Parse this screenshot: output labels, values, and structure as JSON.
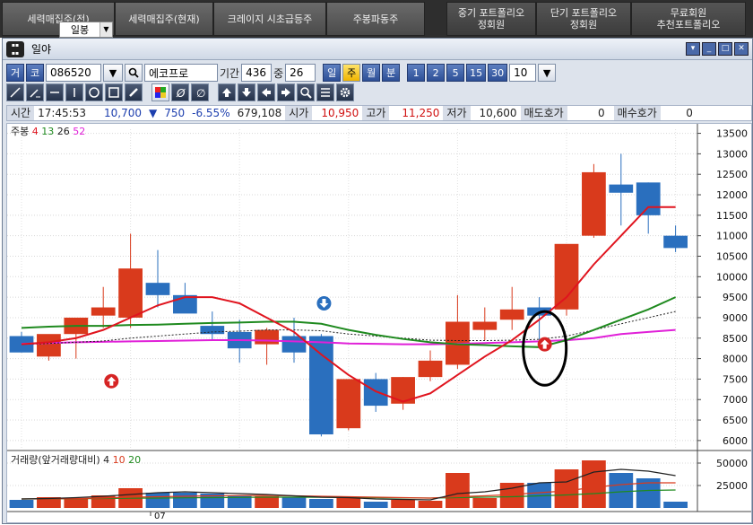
{
  "tabs": [
    {
      "label": "세력매집주(전)"
    },
    {
      "label": "세력매집주(현재)"
    },
    {
      "label": "크레이지 시초급등주"
    },
    {
      "label": "주봉파동주"
    },
    {
      "label": "중기 포트폴리오\n정회원"
    },
    {
      "label": "단기 포트폴리오\n정회원"
    },
    {
      "label": "무료회원\n추천포트폴리오"
    }
  ],
  "period_select": "일봉",
  "window": {
    "title": "일야"
  },
  "toolbar": {
    "geo": "거",
    "code_lbl": "코",
    "code": "086520",
    "name": "에코프로",
    "period_lbl": "기간",
    "period": "436",
    "mid_lbl": "중",
    "mid": "26",
    "p_day": "일",
    "p_week": "주",
    "p_month": "월",
    "p_min": "분",
    "n1": "1",
    "n2": "2",
    "n5": "5",
    "n15": "15",
    "n30": "30",
    "count": "10"
  },
  "quote": {
    "time_lbl": "시간",
    "time": "17:45:53",
    "price": "10,700",
    "change_arrow": "▼",
    "change": "750",
    "pct": "-6.55%",
    "volume": "679,108",
    "open_lbl": "시가",
    "open": "10,950",
    "high_lbl": "고가",
    "high": "11,250",
    "low_lbl": "저가",
    "low": "10,600",
    "ask_lbl": "매도호가",
    "ask": "0",
    "bid_lbl": "매수호가",
    "bid": "0"
  },
  "colors": {
    "up": "#d93a1c",
    "down": "#2a6fbe",
    "ma4": "#e0141e",
    "ma13": "#1f8a1f",
    "ma26": "#222222",
    "ma52": "#e020d8"
  },
  "chart_data": {
    "type": "candlestick",
    "title": "주봉",
    "ma_legend": [
      {
        "label": "4",
        "color": "#e0141e"
      },
      {
        "label": "13",
        "color": "#1f8a1f"
      },
      {
        "label": "26",
        "color": "#222222"
      },
      {
        "label": "52",
        "color": "#e020d8"
      }
    ],
    "ylim": [
      5800,
      13600
    ],
    "yticks": [
      6000,
      6500,
      7000,
      7500,
      8000,
      8500,
      9000,
      9500,
      10000,
      10500,
      11000,
      11500,
      12000,
      12500,
      13000,
      13500
    ],
    "x_label": "07",
    "candles": [
      {
        "o": 8550,
        "h": 8650,
        "l": 8150,
        "c": 8150
      },
      {
        "o": 8050,
        "h": 8550,
        "l": 7950,
        "c": 8600
      },
      {
        "o": 8600,
        "h": 8850,
        "l": 8000,
        "c": 9000
      },
      {
        "o": 9050,
        "h": 9750,
        "l": 8750,
        "c": 9250
      },
      {
        "o": 9000,
        "h": 11050,
        "l": 8750,
        "c": 10200
      },
      {
        "o": 9850,
        "h": 10650,
        "l": 9250,
        "c": 9550
      },
      {
        "o": 9550,
        "h": 9850,
        "l": 9300,
        "c": 9100
      },
      {
        "o": 8800,
        "h": 9150,
        "l": 8450,
        "c": 8600
      },
      {
        "o": 8650,
        "h": 8950,
        "l": 7900,
        "c": 8250
      },
      {
        "o": 8350,
        "h": 8750,
        "l": 7850,
        "c": 8700
      },
      {
        "o": 8550,
        "h": 9000,
        "l": 7900,
        "c": 8150
      },
      {
        "o": 8550,
        "h": 8600,
        "l": 6100,
        "c": 6150
      },
      {
        "o": 6300,
        "h": 7500,
        "l": 6250,
        "c": 7500
      },
      {
        "o": 7500,
        "h": 7650,
        "l": 6700,
        "c": 6850
      },
      {
        "o": 6900,
        "h": 7550,
        "l": 6750,
        "c": 7550
      },
      {
        "o": 7550,
        "h": 8200,
        "l": 7450,
        "c": 7950
      },
      {
        "o": 7850,
        "h": 9550,
        "l": 7750,
        "c": 8900
      },
      {
        "o": 8700,
        "h": 9250,
        "l": 8450,
        "c": 8900
      },
      {
        "o": 8950,
        "h": 9750,
        "l": 8700,
        "c": 9200
      },
      {
        "o": 9250,
        "h": 9500,
        "l": 8450,
        "c": 9050
      },
      {
        "o": 9200,
        "h": 10750,
        "l": 9050,
        "c": 10800
      },
      {
        "o": 11000,
        "h": 12750,
        "l": 10950,
        "c": 12550
      },
      {
        "o": 12250,
        "h": 13000,
        "l": 11250,
        "c": 12050
      },
      {
        "o": 12300,
        "h": 12300,
        "l": 11050,
        "c": 11500
      },
      {
        "o": 11000,
        "h": 11250,
        "l": 10600,
        "c": 10700
      }
    ],
    "ma4": [
      8350,
      8400,
      8500,
      8700,
      9000,
      9300,
      9500,
      9500,
      9350,
      9000,
      8650,
      8100,
      7600,
      7200,
      6950,
      7150,
      7600,
      8050,
      8450,
      8950,
      9500,
      10300,
      11000,
      11700,
      11700
    ],
    "ma13": [
      8750,
      8780,
      8800,
      8800,
      8820,
      8830,
      8850,
      8870,
      8880,
      8900,
      8900,
      8850,
      8700,
      8580,
      8480,
      8400,
      8350,
      8330,
      8300,
      8280,
      8450,
      8700,
      8950,
      9200,
      9500
    ],
    "ma26": [
      8350,
      8370,
      8400,
      8430,
      8500,
      8550,
      8600,
      8650,
      8670,
      8700,
      8700,
      8680,
      8600,
      8550,
      8500,
      8450,
      8440,
      8440,
      8450,
      8470,
      8550,
      8700,
      8850,
      9000,
      9150
    ],
    "ma52": [
      8360,
      8380,
      8400,
      8410,
      8420,
      8430,
      8440,
      8450,
      8450,
      8440,
      8420,
      8400,
      8370,
      8360,
      8350,
      8350,
      8360,
      8380,
      8400,
      8420,
      8450,
      8500,
      8600,
      8650,
      8700
    ],
    "signals": [
      {
        "i": 3.3,
        "type": "up",
        "y": 7450
      },
      {
        "i": 11.1,
        "type": "down",
        "y": 9350
      },
      {
        "i": 19.2,
        "type": "up",
        "y": 8350
      }
    ],
    "ellipse": {
      "i": 19.2,
      "y": 8250,
      "ry": 900
    },
    "volume": {
      "title": "거래량(앞거래량대비)",
      "ma_legend": [
        {
          "label": "4",
          "color": "#222222"
        },
        {
          "label": "10",
          "color": "#d93a1c"
        },
        {
          "label": "20",
          "color": "#1f8a1f"
        }
      ],
      "yticks": [
        25000,
        50000
      ],
      "ylim": [
        0,
        58000
      ],
      "values": [
        9000,
        12000,
        11000,
        14000,
        22000,
        17000,
        17000,
        16000,
        14000,
        13000,
        12000,
        10000,
        11000,
        7000,
        9000,
        8000,
        39000,
        11000,
        28000,
        28000,
        43000,
        53000,
        39000,
        33000,
        7000
      ],
      "ma4": [
        10000,
        10500,
        11500,
        13000,
        15000,
        17000,
        18000,
        17000,
        16000,
        15000,
        13500,
        12000,
        11500,
        10000,
        9500,
        9000,
        16000,
        18000,
        22000,
        28000,
        29000,
        40000,
        43000,
        41000,
        36000
      ],
      "ma10": [
        10000,
        10200,
        10500,
        11000,
        12000,
        12500,
        13000,
        13500,
        13800,
        14000,
        13500,
        13000,
        12500,
        12000,
        11500,
        11000,
        12500,
        13500,
        15000,
        17000,
        19000,
        23000,
        26000,
        28000,
        28000
      ],
      "ma20": [
        10000,
        10100,
        10300,
        10500,
        10800,
        11000,
        11300,
        11500,
        11700,
        12000,
        12000,
        11800,
        11600,
        11400,
        11200,
        11000,
        11500,
        12000,
        12500,
        13500,
        14500,
        16000,
        18000,
        19500,
        20000
      ]
    }
  }
}
